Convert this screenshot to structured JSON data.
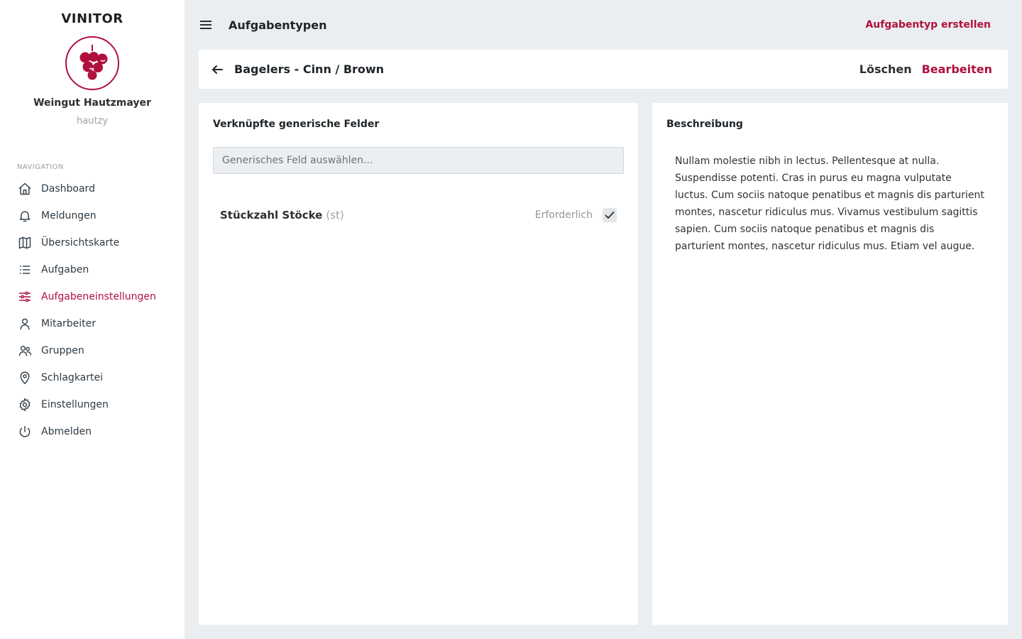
{
  "brand": "VINITOR",
  "organization": {
    "name": "Weingut Hautzmayer",
    "user": "hautzy"
  },
  "navigation": {
    "heading": "NAVIGATION",
    "items": [
      {
        "label": "Dashboard",
        "icon": "home-icon"
      },
      {
        "label": "Meldungen",
        "icon": "bell-icon"
      },
      {
        "label": "Übersichtskarte",
        "icon": "map-icon"
      },
      {
        "label": "Aufgaben",
        "icon": "list-icon"
      },
      {
        "label": "Aufgabeneinstellungen",
        "icon": "sliders-icon",
        "active": true
      },
      {
        "label": "Mitarbeiter",
        "icon": "user-icon"
      },
      {
        "label": "Gruppen",
        "icon": "users-icon"
      },
      {
        "label": "Schlagkartei",
        "icon": "map-pin-icon"
      },
      {
        "label": "Einstellungen",
        "icon": "gear-icon"
      },
      {
        "label": "Abmelden",
        "icon": "power-icon"
      }
    ]
  },
  "topbar": {
    "title": "Aufgabentypen",
    "action": "Aufgabentyp erstellen"
  },
  "header": {
    "title": "Bagelers - Cinn / Brown",
    "delete_label": "Löschen",
    "edit_label": "Bearbeiten"
  },
  "linked_fields": {
    "title": "Verknüpfte generische Felder",
    "select_placeholder": "Generisches Feld auswählen...",
    "fields": [
      {
        "name": "Stückzahl Stöcke",
        "unit": "(st)",
        "required_label": "Erforderlich",
        "required": true
      }
    ]
  },
  "description": {
    "title": "Beschreibung",
    "text": "Nullam molestie nibh in lectus. Pellentesque at nulla. Suspendisse potenti. Cras in purus eu magna vulputate luctus. Cum sociis natoque penatibus et magnis dis parturient montes, nascetur ridiculus mus. Vivamus vestibulum sagittis sapien. Cum sociis natoque penatibus et magnis dis parturient montes, nascetur ridiculus mus. Etiam vel augue."
  },
  "colors": {
    "accent": "#b0103e",
    "background": "#ebeef1",
    "surface": "#ffffff"
  }
}
